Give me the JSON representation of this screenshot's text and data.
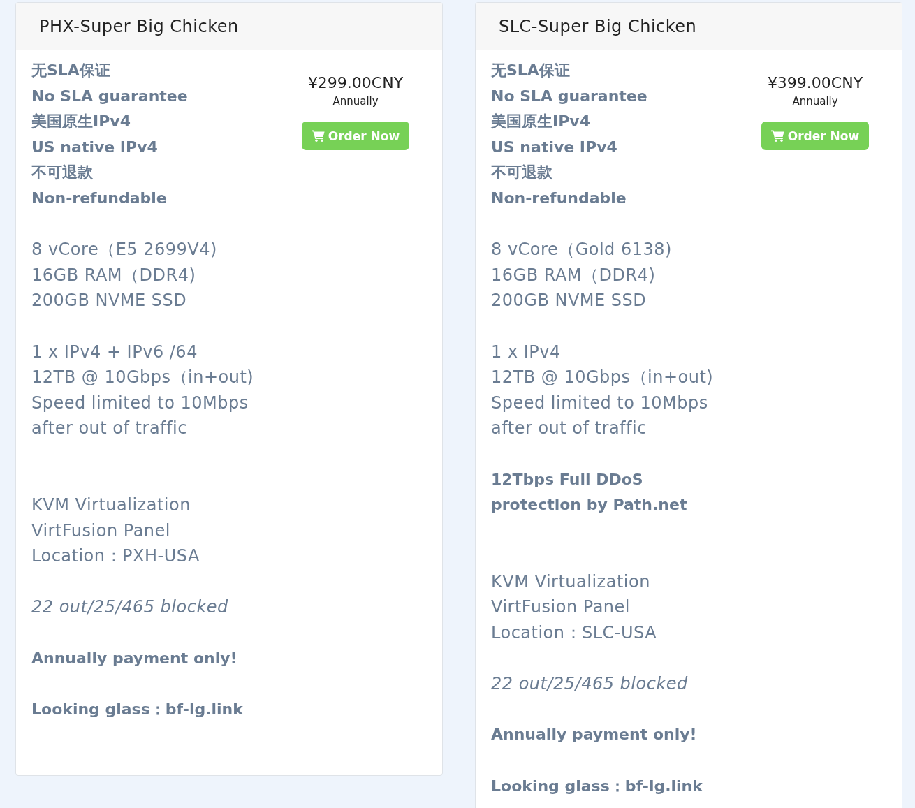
{
  "plans": [
    {
      "title": "PHX-Super Big Chicken",
      "price": "¥299.00CNY",
      "billing_cycle": "Annually",
      "order_button": "Order Now",
      "features": [
        {
          "kind": "bold",
          "text": "无SLA保证"
        },
        {
          "kind": "bold",
          "text": "No SLA guarantee"
        },
        {
          "kind": "bold",
          "text": "美国原生IPv4"
        },
        {
          "kind": "bold",
          "text": "US native IPv4"
        },
        {
          "kind": "bold",
          "text": "不可退款"
        },
        {
          "kind": "bold",
          "text": "Non-refundable"
        },
        {
          "kind": "blank"
        },
        {
          "kind": "normal",
          "text": "8 vCore（E5 2699V4)"
        },
        {
          "kind": "normal",
          "text": "16GB RAM（DDR4)"
        },
        {
          "kind": "normal",
          "text": "200GB NVME SSD"
        },
        {
          "kind": "blank"
        },
        {
          "kind": "normal",
          "text": "1 x IPv4 + IPv6 /64"
        },
        {
          "kind": "normal",
          "text": "12TB @ 10Gbps（in+out)"
        },
        {
          "kind": "normal",
          "text": "Speed limited to 10Mbps"
        },
        {
          "kind": "normal",
          "text": "after out of traffic"
        },
        {
          "kind": "blank"
        },
        {
          "kind": "blank"
        },
        {
          "kind": "normal",
          "text": "KVM Virtualization"
        },
        {
          "kind": "normal",
          "text": "VirtFusion Panel"
        },
        {
          "kind": "normal",
          "text": "Location：PXH-USA"
        },
        {
          "kind": "blank"
        },
        {
          "kind": "italic",
          "text": "22 out/25/465 blocked"
        },
        {
          "kind": "blank"
        },
        {
          "kind": "bold",
          "text": "Annually payment only!"
        },
        {
          "kind": "blank"
        },
        {
          "kind": "bold",
          "text": "Looking glass：bf-lg.link"
        }
      ]
    },
    {
      "title": "SLC-Super Big Chicken",
      "price": "¥399.00CNY",
      "billing_cycle": "Annually",
      "order_button": "Order Now",
      "features": [
        {
          "kind": "bold",
          "text": "无SLA保证"
        },
        {
          "kind": "bold",
          "text": "No SLA guarantee"
        },
        {
          "kind": "bold",
          "text": "美国原生IPv4"
        },
        {
          "kind": "bold",
          "text": "US native IPv4"
        },
        {
          "kind": "bold",
          "text": "不可退款"
        },
        {
          "kind": "bold",
          "text": "Non-refundable"
        },
        {
          "kind": "blank"
        },
        {
          "kind": "normal",
          "text": "8 vCore（Gold 6138)"
        },
        {
          "kind": "normal",
          "text": "16GB RAM（DDR4)"
        },
        {
          "kind": "normal",
          "text": "200GB NVME SSD"
        },
        {
          "kind": "blank"
        },
        {
          "kind": "normal",
          "text": "1 x IPv4"
        },
        {
          "kind": "normal",
          "text": "12TB @ 10Gbps（in+out)"
        },
        {
          "kind": "normal",
          "text": "Speed limited to 10Mbps"
        },
        {
          "kind": "normal",
          "text": "after out of traffic"
        },
        {
          "kind": "blank"
        },
        {
          "kind": "bold",
          "text": "12Tbps Full DDoS"
        },
        {
          "kind": "bold",
          "text": "protection by Path.net"
        },
        {
          "kind": "blank"
        },
        {
          "kind": "blank"
        },
        {
          "kind": "normal",
          "text": "KVM Virtualization"
        },
        {
          "kind": "normal",
          "text": "VirtFusion Panel"
        },
        {
          "kind": "normal",
          "text": "Location：SLC-USA"
        },
        {
          "kind": "blank"
        },
        {
          "kind": "italic",
          "text": "22 out/25/465 blocked"
        },
        {
          "kind": "blank"
        },
        {
          "kind": "bold",
          "text": "Annually payment only!"
        },
        {
          "kind": "blank"
        },
        {
          "kind": "bold",
          "text": "Looking glass：bf-lg.link"
        }
      ]
    }
  ]
}
